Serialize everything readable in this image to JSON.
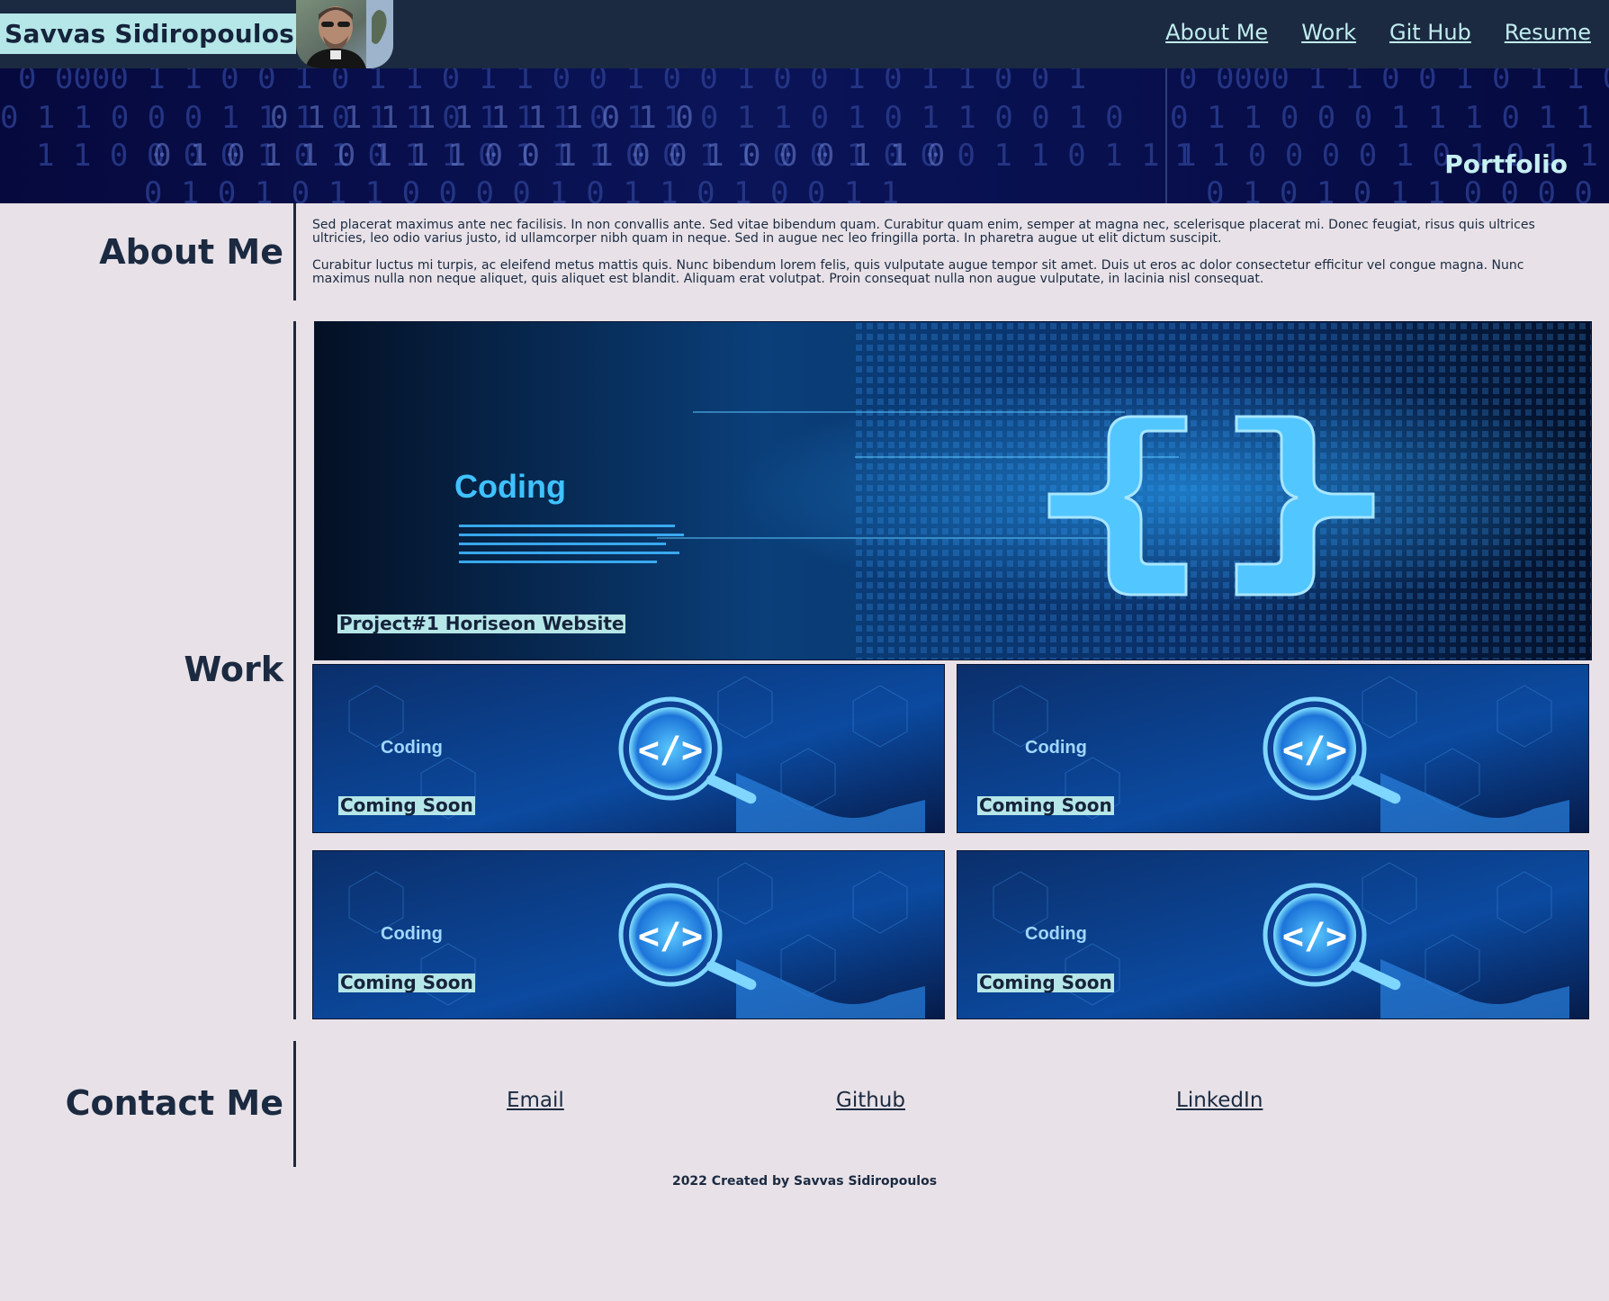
{
  "header": {
    "name": "Savvas Sidiropoulos",
    "nav": [
      "About Me",
      "Work",
      "Git Hub",
      "Resume"
    ]
  },
  "banner": {
    "title": "Portfolio",
    "binary_rows": [
      "0  0000  1 1 0 0 1 0 1 1 0 1 1 0 0 1 0 0 1 0 0 1 0 1 1 0 0 1",
      "0 1 1 0 0 0 1 1 1 0 1 1 0 1 1 1 0 1 1 0 1 1 0 1 0 1 1 0 0 1 0",
      "1 1 0 0 0 0 1 0 1 0 1 1 0 1 1 1 0 0 1 1 0 0 1 0 0 0 1 1 0 1 1 1",
      "0 1 0 1 0 1 1 0 0 0 0 1 0 1 1 0 1 0 0 1 1"
    ]
  },
  "about": {
    "heading": "About Me",
    "paragraphs": [
      "Sed placerat maximus ante nec facilisis. In non convallis ante. Sed vitae bibendum quam. Curabitur quam enim, semper at magna nec, scelerisque placerat mi. Donec feugiat, risus quis ultrices ultricies, leo odio varius justo, id ullamcorper nibh quam in neque. Sed in augue nec leo fringilla porta. In pharetra augue ut elit dictum suscipit.",
      "Curabitur luctus mi turpis, ac eleifend metus mattis quis. Nunc bibendum lorem felis, quis vulputate augue tempor sit amet. Duis ut eros ac dolor consectetur efficitur vel congue magna. Nunc maximus nulla non neque aliquet, quis aliquet est blandit. Aliquam erat volutpat. Proin consequat nulla non augue vulputate, in lacinia nisl consequat."
    ]
  },
  "work": {
    "heading": "Work",
    "featured": {
      "label": "Project#1 Horiseon Website",
      "image_text": "Coding"
    },
    "cards": [
      {
        "label": "Coming Soon",
        "image_text": "Coding"
      },
      {
        "label": "Coming Soon",
        "image_text": "Coding"
      },
      {
        "label": "Coming Soon",
        "image_text": "Coding"
      },
      {
        "label": "Coming Soon",
        "image_text": "Coding"
      }
    ]
  },
  "contact": {
    "heading": "Contact Me",
    "links": [
      "Email",
      "Github",
      "LinkedIn"
    ]
  },
  "footer": {
    "text": "2022 Created by Savvas Sidiropoulos"
  }
}
